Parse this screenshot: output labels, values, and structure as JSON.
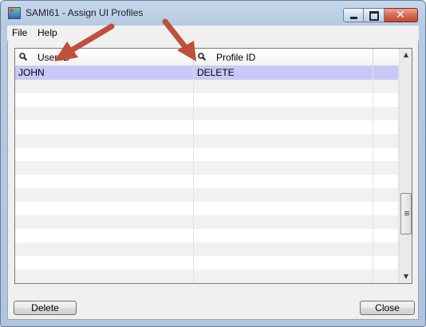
{
  "window": {
    "title": "SAMI61 - Assign UI Profiles"
  },
  "menu": {
    "file": "File",
    "help": "Help"
  },
  "grid": {
    "columns": [
      "User ID",
      "Profile ID"
    ],
    "rows": [
      {
        "user": "JOHN",
        "profile": "DELETE"
      }
    ]
  },
  "buttons": {
    "delete": "Delete",
    "close": "Close"
  },
  "colors": {
    "selected_row": "#c8c8f8",
    "annotation_arrow": "#c0503a"
  },
  "icons": [
    "app-icon",
    "search-icon",
    "minimize-icon",
    "maximize-icon",
    "close-icon",
    "arrow-up-icon",
    "arrow-down-icon"
  ]
}
